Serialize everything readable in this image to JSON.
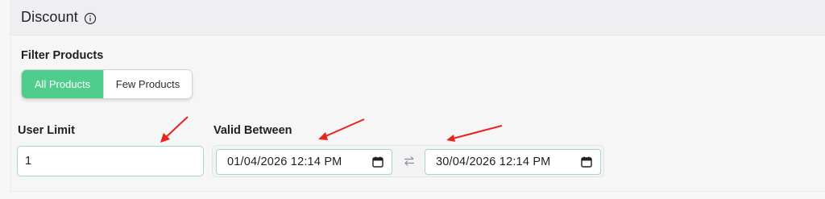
{
  "card": {
    "title": "Discount",
    "title_icon": "info-icon"
  },
  "filter": {
    "label": "Filter Products",
    "options": [
      "All Products",
      "Few Products"
    ],
    "selected": "All Products"
  },
  "user_limit": {
    "label": "User Limit",
    "value": "1"
  },
  "valid_between": {
    "label": "Valid Between",
    "start": "01/04/2026 12:14 PM",
    "end": "30/04/2026 12:14 PM",
    "separator_icon": "swap-arrows-icon",
    "picker_icon": "calendar-icon"
  },
  "colors": {
    "accent": "#4fcd8d",
    "input_border": "#9fdcbc",
    "annotation_arrow": "#e8231c"
  },
  "annotations": {
    "arrow_count": 3,
    "arrow_icon": "red-arrow-icon"
  }
}
